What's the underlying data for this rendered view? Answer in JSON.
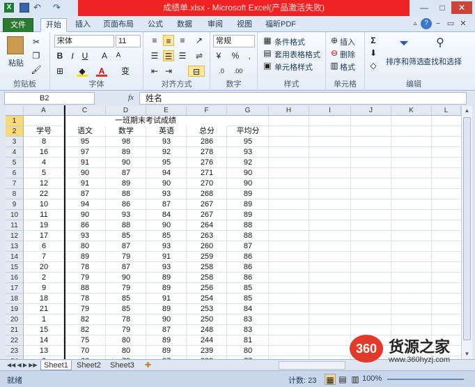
{
  "window": {
    "title": "成绩单.xlsx - Microsoft Excel(产品激活失败)"
  },
  "tabs": [
    "文件",
    "开始",
    "插入",
    "页面布局",
    "公式",
    "数据",
    "审阅",
    "视图",
    "福昕PDF"
  ],
  "ribbon": {
    "paste": "粘贴",
    "clipboard": "剪贴板",
    "font_name": "宋体",
    "font_size": "11",
    "font_group": "字体",
    "bold": "B",
    "italic": "I",
    "underline": "U",
    "font_color": "A",
    "phonetic": "变",
    "align_group": "对齐方式",
    "number_format": "常规",
    "number_group": "数字",
    "percent": "%",
    "comma": ",",
    "cond_format": "条件格式",
    "table_format": "套用表格格式",
    "cell_style": "单元格样式",
    "style_group": "样式",
    "insert": "插入",
    "delete": "删除",
    "format": "格式",
    "cells_group": "单元格",
    "sum": "Σ",
    "sort_filter": "排序和筛选",
    "find_select": "查找和选择",
    "edit_group": "编辑"
  },
  "formula_bar": {
    "name_box": "B2",
    "fx": "fx",
    "content": "姓名"
  },
  "columns": [
    "A",
    "C",
    "D",
    "E",
    "F",
    "G",
    "H",
    "I",
    "J",
    "K",
    "L"
  ],
  "table": {
    "title": "一班期末考试成绩",
    "headers": [
      "学号",
      "语文",
      "数学",
      "英语",
      "总分",
      "平均分"
    ],
    "rows": [
      [
        "8",
        "95",
        "98",
        "93",
        "286",
        "95"
      ],
      [
        "16",
        "97",
        "89",
        "92",
        "278",
        "93"
      ],
      [
        "4",
        "91",
        "90",
        "95",
        "276",
        "92"
      ],
      [
        "5",
        "90",
        "87",
        "94",
        "271",
        "90"
      ],
      [
        "12",
        "91",
        "89",
        "90",
        "270",
        "90"
      ],
      [
        "22",
        "87",
        "88",
        "93",
        "268",
        "89"
      ],
      [
        "10",
        "94",
        "86",
        "87",
        "267",
        "89"
      ],
      [
        "11",
        "90",
        "93",
        "84",
        "267",
        "89"
      ],
      [
        "19",
        "86",
        "88",
        "90",
        "264",
        "88"
      ],
      [
        "17",
        "93",
        "85",
        "85",
        "263",
        "88"
      ],
      [
        "6",
        "80",
        "87",
        "93",
        "260",
        "87"
      ],
      [
        "7",
        "89",
        "79",
        "91",
        "259",
        "86"
      ],
      [
        "20",
        "78",
        "87",
        "93",
        "258",
        "86"
      ],
      [
        "2",
        "79",
        "90",
        "89",
        "258",
        "86"
      ],
      [
        "9",
        "88",
        "79",
        "89",
        "256",
        "85"
      ],
      [
        "18",
        "78",
        "85",
        "91",
        "254",
        "85"
      ],
      [
        "21",
        "79",
        "85",
        "89",
        "253",
        "84"
      ],
      [
        "1",
        "82",
        "78",
        "90",
        "250",
        "83"
      ],
      [
        "15",
        "82",
        "79",
        "87",
        "248",
        "83"
      ],
      [
        "14",
        "75",
        "80",
        "89",
        "244",
        "81"
      ],
      [
        "13",
        "70",
        "80",
        "89",
        "239",
        "80"
      ],
      [
        "3",
        "66",
        "79",
        "87",
        "232",
        "77"
      ]
    ]
  },
  "sheets": [
    "Sheet1",
    "Sheet2",
    "Sheet3"
  ],
  "status": {
    "ready": "就绪",
    "count": "计数: 23",
    "zoom": "100%"
  },
  "watermark": {
    "badge": "360",
    "name": "货源之家",
    "url": "www.360hyzj.com"
  }
}
